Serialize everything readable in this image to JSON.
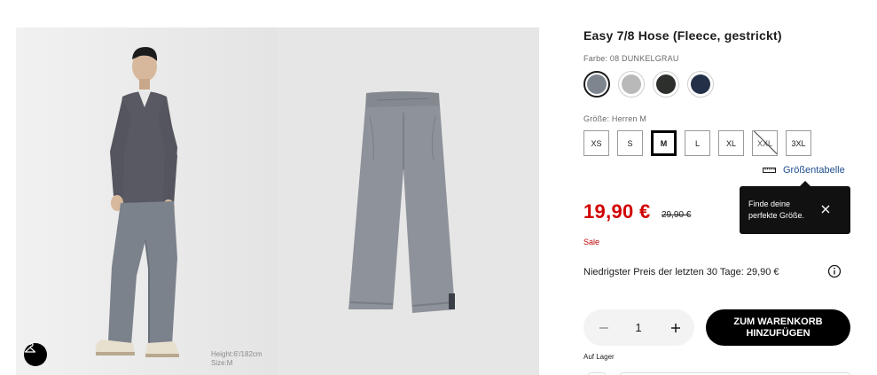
{
  "product": {
    "title": "Easy 7/8 Hose (Fleece, gestrickt)",
    "color_label": "Farbe: 08 DUNKELGRAU",
    "colors": [
      {
        "name": "dark-gray",
        "hex": "#7f858f",
        "selected": true
      },
      {
        "name": "light-gray",
        "hex": "#b9b9b9",
        "selected": false
      },
      {
        "name": "black",
        "hex": "#2d2f2d",
        "selected": false
      },
      {
        "name": "navy",
        "hex": "#243047",
        "selected": false
      }
    ],
    "size_label": "Größe: Herren M",
    "sizes": [
      {
        "label": "XS",
        "selected": false,
        "sold_out": false
      },
      {
        "label": "S",
        "selected": false,
        "sold_out": false
      },
      {
        "label": "M",
        "selected": true,
        "sold_out": false
      },
      {
        "label": "L",
        "selected": false,
        "sold_out": false
      },
      {
        "label": "XL",
        "selected": false,
        "sold_out": false
      },
      {
        "label": "XXL",
        "selected": false,
        "sold_out": true
      },
      {
        "label": "3XL",
        "selected": false,
        "sold_out": false
      }
    ],
    "size_chart_link": "Größentabelle",
    "tooltip_text": "Finde deine perfekte Größe.",
    "price": "19,90 €",
    "old_price": "29,90 €",
    "sale_label": "Sale",
    "lowest_price_text": "Niedrigster Preis der letzten 30 Tage: 29,90 €",
    "quantity": "1",
    "add_to_cart_label": "ZUM WARENKORB HINZUFÜGEN",
    "stock_status": "Auf Lager"
  },
  "gallery": {
    "caption_height": "Height:6'/182cm",
    "caption_size": "Size:M",
    "icons": [
      "hanger-icon"
    ]
  },
  "colors": {
    "price_red": "#d10000",
    "link_blue": "#1f4e8c",
    "button_black": "#000000"
  }
}
